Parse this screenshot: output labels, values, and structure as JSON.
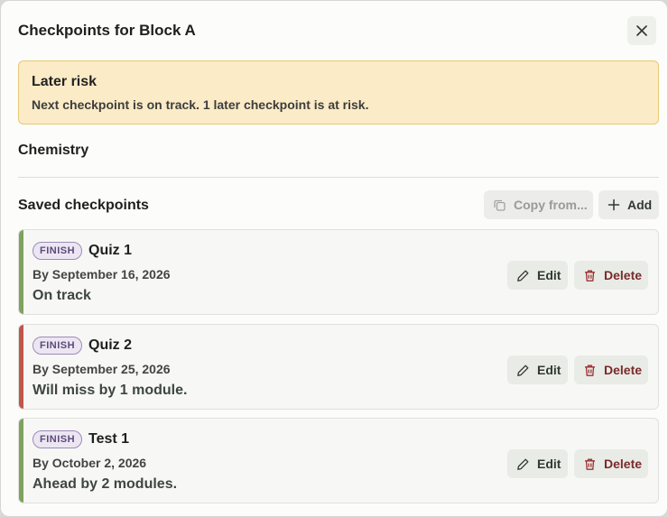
{
  "dialog": {
    "title": "Checkpoints for Block A"
  },
  "alert": {
    "title": "Later risk",
    "text": "Next checkpoint is on track. 1 later checkpoint is at risk."
  },
  "subject": "Chemistry",
  "saved": {
    "title": "Saved checkpoints",
    "copy_label": "Copy from...",
    "add_label": "Add"
  },
  "checkpoints": [
    {
      "badge": "FINISH",
      "name": "Quiz 1",
      "date": "By September 16, 2026",
      "status": "On track",
      "status_color": "#7da35f",
      "edit_label": "Edit",
      "delete_label": "Delete"
    },
    {
      "badge": "FINISH",
      "name": "Quiz 2",
      "date": "By September 25, 2026",
      "status": "Will miss by 1 module.",
      "status_color": "#c0554a",
      "edit_label": "Edit",
      "delete_label": "Delete"
    },
    {
      "badge": "FINISH",
      "name": "Test 1",
      "date": "By October 2, 2026",
      "status": "Ahead by 2 modules.",
      "status_color": "#7da35f",
      "edit_label": "Edit",
      "delete_label": "Delete"
    }
  ],
  "colors": {
    "alert_bg": "#fbebc6",
    "alert_border": "#e8c977",
    "on_track": "#7da35f",
    "at_risk": "#c0554a",
    "delete_text": "#7a2a2a"
  }
}
